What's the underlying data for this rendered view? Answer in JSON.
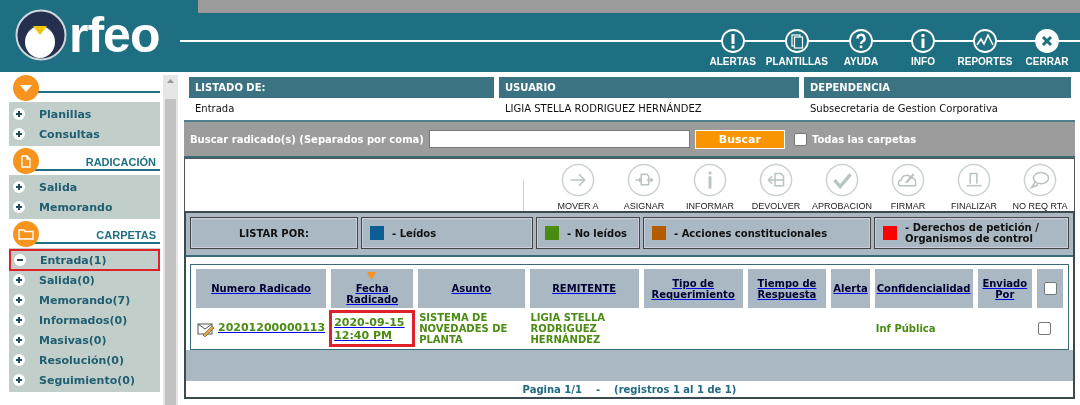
{
  "header": {
    "logo_text": "rfeo",
    "nav": [
      {
        "label": "ALERTAS",
        "kind": "alert"
      },
      {
        "label": "PLANTILLAS",
        "kind": "templates"
      },
      {
        "label": "AYUDA",
        "kind": "help"
      },
      {
        "label": "INFO",
        "kind": "info"
      },
      {
        "label": "REPORTES",
        "kind": "chart"
      },
      {
        "label": "CERRAR",
        "kind": "close"
      }
    ]
  },
  "sidebar": {
    "sections": [
      {
        "kind": "caret",
        "items": [
          {
            "label": "Planillas",
            "selected": false
          },
          {
            "label": "Consultas",
            "selected": false
          }
        ]
      },
      {
        "kind": "document",
        "title": "RADICACIÓN",
        "items": [
          {
            "label": "Salida",
            "selected": false
          },
          {
            "label": "Memorando",
            "selected": false
          }
        ]
      },
      {
        "kind": "folder",
        "title": "CARPETAS",
        "items": [
          {
            "label": "Entrada(1)",
            "selected": true
          },
          {
            "label": "Salida(0)",
            "selected": false
          },
          {
            "label": "Memorando(7)",
            "selected": false
          },
          {
            "label": "Informados(0)",
            "selected": false
          },
          {
            "label": "Masivas(0)",
            "selected": false
          },
          {
            "label": "Resolución(0)",
            "selected": false
          },
          {
            "label": "Seguimiento(0)",
            "selected": false
          }
        ]
      }
    ]
  },
  "info": [
    {
      "label": "LISTADO DE:",
      "value": "Entrada"
    },
    {
      "label": "USUARIO",
      "value": "LIGIA STELLA RODRIGUEZ HERNÁNDEZ"
    },
    {
      "label": "DEPENDENCIA",
      "value": "Subsecretaria de Gestion Corporativa"
    }
  ],
  "search": {
    "label": "Buscar radicado(s) (Separados por coma)",
    "button": "Buscar",
    "all_folders": {
      "label": "Todas las carpetas",
      "checked": false
    }
  },
  "actions": [
    {
      "label": "MOVER A",
      "kind": "move"
    },
    {
      "label": "ASIGNAR",
      "kind": "assign"
    },
    {
      "label": "INFORMAR",
      "kind": "info"
    },
    {
      "label": "DEVOLVER",
      "kind": "return"
    },
    {
      "label": "APROBACION",
      "kind": "approve"
    },
    {
      "label": "FIRMAR",
      "kind": "sign"
    },
    {
      "label": "FINALIZAR",
      "kind": "finish"
    },
    {
      "label": "NO REQ RTA",
      "kind": "noreply"
    }
  ],
  "legend": {
    "label": "LISTAR POR:",
    "items": [
      {
        "label": "- Leídos",
        "color": "#0b5f95"
      },
      {
        "label": "- No leídos",
        "color": "#4a8b12"
      },
      {
        "label": "- Acciones constitucionales",
        "color": "#b35c00"
      },
      {
        "label": "- Derechos de petición / Organismos de control",
        "color": "#ff0000"
      }
    ]
  },
  "table": {
    "columns": [
      {
        "label": "Numero Radicado",
        "sorted": false
      },
      {
        "label": "Fecha Radicado",
        "sorted": true
      },
      {
        "label": "Asunto",
        "sorted": false
      },
      {
        "label": "REMITENTE",
        "sorted": false
      },
      {
        "label": "Tipo de Requerimiento",
        "sorted": false
      },
      {
        "label": "Tiempo de Respuesta",
        "sorted": false
      },
      {
        "label": "Alerta",
        "sorted": false
      },
      {
        "label": "Confidencialidad",
        "sorted": false
      },
      {
        "label": "Enviado Por",
        "sorted": false
      }
    ],
    "select_all_checked": false,
    "rows": [
      {
        "number": "20201200000113",
        "date": "2020-09-15 12:40 PM",
        "date_highlighted": true,
        "subject": "SISTEMA DE NOVEDADES DE PLANTA",
        "sender": "LIGIA STELLA RODRIGUEZ HERNÁNDEZ",
        "confidentiality": "Inf Pública",
        "checked": false
      }
    ]
  },
  "pagination": {
    "page": "Pagina 1/1",
    "separator": "-",
    "records": "(registros 1 al 1 de 1)"
  }
}
